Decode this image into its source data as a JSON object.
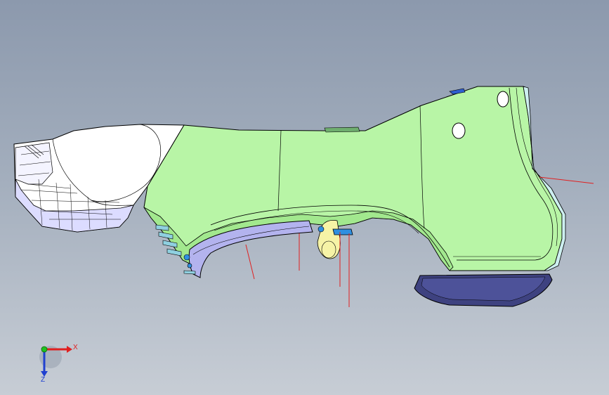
{
  "viewport": {
    "background_top": "#8c99ad",
    "background_bottom": "#c7cdd5"
  },
  "model": {
    "panel_fill": "#b8f5a6",
    "panel_dark": "#8ed67e",
    "wheel_arch_fill": "#b3b3ee",
    "mudflap_fill": "#3e4280",
    "hidden_part_fill": "#ffffff",
    "bracket_fill": "#f6f3a6",
    "clip_fill": "#2f8fe0",
    "edge_color": "#000000",
    "annotation_line_color": "#e02020"
  },
  "compass": {
    "x_label": "X",
    "z_label": "Z",
    "x_color": "#e02020",
    "y_color": "#20c020",
    "z_color": "#2040d0"
  }
}
